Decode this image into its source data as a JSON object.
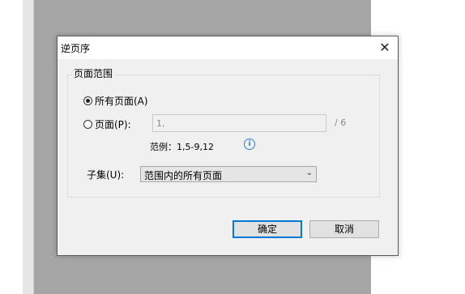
{
  "dialog": {
    "title": "逆页序",
    "close_glyph": "✕",
    "group_label": "页面范围",
    "all_pages_label": "所有页面(A)",
    "all_pages_selected": true,
    "pages_label": "页面(P):",
    "pages_selected": false,
    "pages_input_value": "1,",
    "page_total": "/ 6",
    "example_text": "范例：1,5-9,12",
    "info_icon": "i",
    "subset_label": "子集(U):",
    "subset_value": "范围内的所有页面",
    "ok_label": "确定",
    "cancel_label": "取消"
  },
  "colors": {
    "dialog_bg": "#f0f0f0",
    "page_bg": "#a6a6a6",
    "accent": "#0078d7",
    "info": "#2e7fd1"
  }
}
